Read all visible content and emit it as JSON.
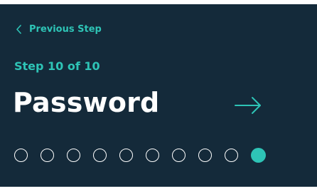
{
  "colors": {
    "panel_background": "#142a3a",
    "accent": "#2ec4b6",
    "text_primary": "#ffffff"
  },
  "nav": {
    "back_label": "Previous Step",
    "back_icon": "chevron-left-icon",
    "next_icon": "arrow-right-icon"
  },
  "step": {
    "counter_label": "Step 10 of 10",
    "current": 10,
    "total": 10
  },
  "title": "Password",
  "progress_dots": [
    {
      "state": "inactive"
    },
    {
      "state": "inactive"
    },
    {
      "state": "inactive"
    },
    {
      "state": "inactive"
    },
    {
      "state": "inactive"
    },
    {
      "state": "inactive"
    },
    {
      "state": "inactive"
    },
    {
      "state": "inactive"
    },
    {
      "state": "inactive"
    },
    {
      "state": "active"
    }
  ]
}
